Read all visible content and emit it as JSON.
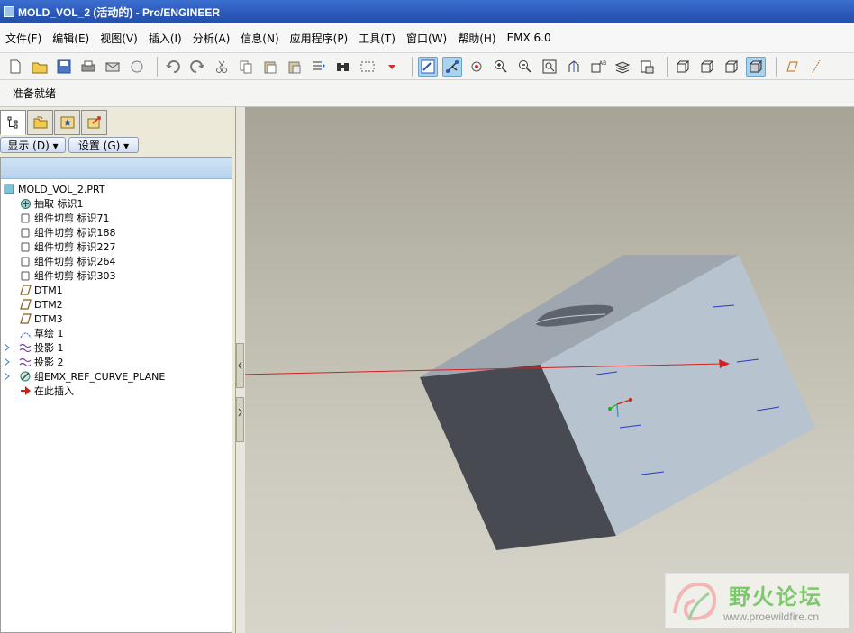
{
  "window": {
    "title": "MOLD_VOL_2 (活动的) - Pro/ENGINEER"
  },
  "menubar": [
    "文件(F)",
    "编辑(E)",
    "视图(V)",
    "插入(I)",
    "分析(A)",
    "信息(N)",
    "应用程序(P)",
    "工具(T)",
    "窗口(W)",
    "帮助(H)",
    "EMX 6.0"
  ],
  "message": "准备就绪",
  "navigator": {
    "show_label": "显示 (D) ▾",
    "settings_label": "设置 (G) ▾",
    "tree": [
      {
        "label": "MOLD_VOL_2.PRT",
        "icon": "part-icon"
      },
      {
        "label": "抽取 标识1",
        "icon": "extract-icon"
      },
      {
        "label": "组件切剪 标识71",
        "icon": "cut-icon"
      },
      {
        "label": "组件切剪 标识188",
        "icon": "cut-icon"
      },
      {
        "label": "组件切剪 标识227",
        "icon": "cut-icon"
      },
      {
        "label": "组件切剪 标识264",
        "icon": "cut-icon"
      },
      {
        "label": "组件切剪 标识303",
        "icon": "cut-icon"
      },
      {
        "label": "DTM1",
        "icon": "datum-plane-icon"
      },
      {
        "label": "DTM2",
        "icon": "datum-plane-icon"
      },
      {
        "label": "DTM3",
        "icon": "datum-plane-icon"
      },
      {
        "label": "草绘 1",
        "icon": "sketch-icon"
      },
      {
        "label": "投影 1",
        "icon": "projection-icon"
      },
      {
        "label": "投影 2",
        "icon": "projection-icon"
      },
      {
        "label": "组EMX_REF_CURVE_PLANE",
        "icon": "group-icon"
      },
      {
        "label": "在此插入",
        "icon": "insert-arrow-icon"
      }
    ]
  },
  "watermark": {
    "title": "野火论坛",
    "url": "www.proewildfire.cn"
  },
  "colors": {
    "titlebar": "#2a57b8",
    "annotation_arrow": "#d42020",
    "part_face": "#b7c3cf"
  }
}
